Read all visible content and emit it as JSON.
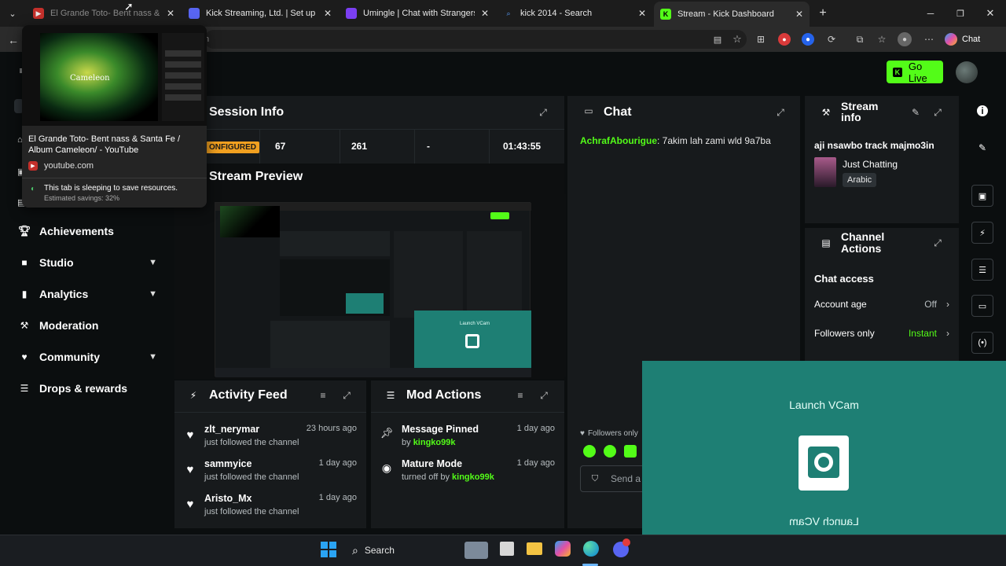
{
  "browser": {
    "tabs": [
      {
        "title": "El Grande Toto- Bent nass & Santa",
        "color": "#c4302b"
      },
      {
        "title": "Kick Streaming, Ltd. | Set up paym",
        "color": "#5865f2"
      },
      {
        "title": "Umingle | Chat with Strangers Inst",
        "color": "#7b3ff2"
      },
      {
        "title": "kick 2014 - Search",
        "color": "#3b82f6"
      },
      {
        "title": "Stream - Kick Dashboard",
        "color": "#53fc18"
      }
    ],
    "chat_button": "Chat"
  },
  "hover_card": {
    "title": "El Grande Toto- Bent nass & Santa Fe / Album Cameleon/ - YouTube",
    "domain": "youtube.com",
    "sleep_note": "This tab is sleeping to save resources.",
    "savings": "Estimated savings: 32%",
    "thumb_text": "Cameleon"
  },
  "header": {
    "go_live": "Go Live"
  },
  "sidebar": {
    "items": [
      {
        "label": "Achievements",
        "icon": "trophy-icon",
        "chevron": false
      },
      {
        "label": "Studio",
        "icon": "video-icon",
        "chevron": true
      },
      {
        "label": "Analytics",
        "icon": "chart-icon",
        "chevron": true
      },
      {
        "label": "Moderation",
        "icon": "wrench-icon",
        "chevron": false
      },
      {
        "label": "Community",
        "icon": "heart-icon",
        "chevron": true
      },
      {
        "label": "Drops & rewards",
        "icon": "list-icon",
        "chevron": false
      }
    ]
  },
  "session": {
    "title": "Session Info",
    "status": "ONFIGURED",
    "viewers": "67",
    "followers": "261",
    "subs": "-",
    "duration": "01:43:55"
  },
  "preview": {
    "title": "Stream Preview"
  },
  "activity": {
    "title": "Activity Feed",
    "items": [
      {
        "name": "zlt_nerymar",
        "action": "just followed the channel",
        "time": "23 hours ago"
      },
      {
        "name": "sammyice",
        "action": "just followed the channel",
        "time": "1 day ago"
      },
      {
        "name": "Aristo_Mx",
        "action": "just followed the channel",
        "time": "1 day ago"
      }
    ]
  },
  "mod": {
    "title": "Mod Actions",
    "items": [
      {
        "name": "Message Pinned",
        "prefix": "by",
        "user": "kingko99k",
        "time": "1 day ago"
      },
      {
        "name": "Mature Mode",
        "prefix": "turned off by",
        "user": "kingko99k",
        "time": "1 day ago"
      }
    ]
  },
  "chat": {
    "title": "Chat",
    "messages": [
      {
        "user": "AchrafAbourigue",
        "text": ": 7akim lah zami wld 9a7ba"
      }
    ],
    "followers_only": "Followers only",
    "send_placeholder": "Send a"
  },
  "stream_info": {
    "title_line1": "Stream",
    "title_line2": "info",
    "stream_title": "aji nsawbo track majmo3in",
    "category": "Just Chatting",
    "tag": "Arabic"
  },
  "channel_actions": {
    "title_line1": "Channel",
    "title_line2": "Actions",
    "section": "Chat access",
    "rows": [
      {
        "label": "Account age",
        "value": "Off"
      },
      {
        "label": "Followers only",
        "value": "Instant"
      }
    ]
  },
  "vcam": {
    "label_top": "Launch VCam",
    "label_bottom": "Launch VCam"
  },
  "taskbar": {
    "search": "Search"
  }
}
